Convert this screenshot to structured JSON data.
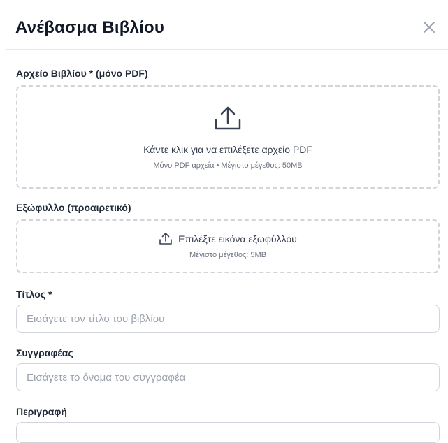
{
  "modal": {
    "title": "Ανέβασμα Βιβλίου",
    "close_icon": "close-icon"
  },
  "pdf_upload": {
    "label": "Αρχείο Βιβλίου * (μόνο PDF)",
    "icon": "upload-icon",
    "main_text": "Κάντε κλικ για να επιλέξετε αρχείο PDF",
    "sub_text": "Μόνο PDF αρχεία • Μέγιστο μέγεθος: 50MB"
  },
  "cover_upload": {
    "label": "Εξώφυλλο (προαιρετικό)",
    "icon": "upload-icon",
    "main_text": "Επιλέξτε εικόνα εξωφύλλου",
    "sub_text": "Μέγιστο μέγεθος: 5MB"
  },
  "title_field": {
    "label": "Τίτλος *",
    "value": "",
    "placeholder": "Εισάγετε τον τίτλο του βιβλίου"
  },
  "author_field": {
    "label": "Συγγραφέας",
    "value": "",
    "placeholder": "Εισάγετε το όνομα του συγγραφέα"
  },
  "description_field": {
    "label": "Περιγραφή"
  },
  "colors": {
    "border": "#d1d5db",
    "text": "#111827",
    "muted": "#6b7280",
    "placeholder": "#9ca3af"
  }
}
